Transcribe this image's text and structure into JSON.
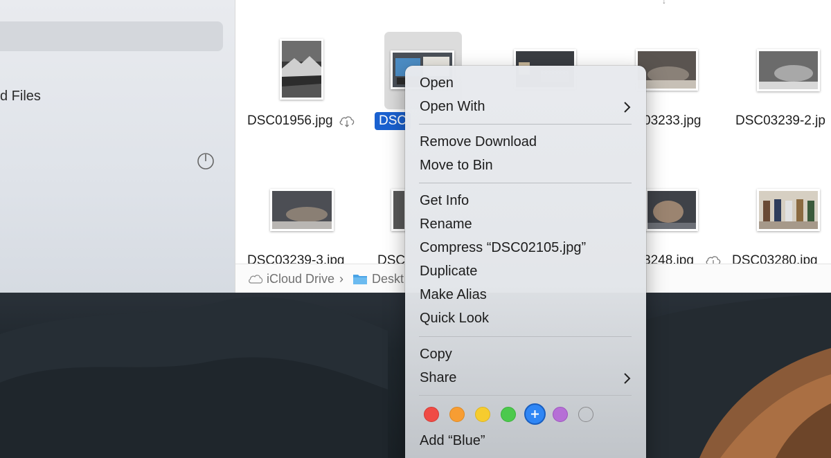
{
  "sidebar": {
    "item_label": "d Files",
    "storage_icon": "storage-progress-icon"
  },
  "files": [
    {
      "name": "DSC01956.jpg",
      "cloud": true
    },
    {
      "name": "DSC",
      "selected": true
    },
    {
      "name": "03233.jpg"
    },
    {
      "name": "DSC03239-2.jp"
    },
    {
      "name": "DSC03239-3.jpg"
    },
    {
      "name": "DSC"
    },
    {
      "name": "3248.jpg",
      "cloud": true
    },
    {
      "name": "DSC03280.jpg",
      "cloud": true
    }
  ],
  "pathbar": {
    "drive": "iCloud Drive",
    "separator": "›",
    "folder": "Deskt"
  },
  "context_menu": {
    "items": [
      {
        "label": "Open"
      },
      {
        "label": "Open With",
        "submenu": true
      },
      {
        "label": "Remove Download"
      },
      {
        "label": "Move to Bin"
      },
      {
        "label": "Get Info"
      },
      {
        "label": "Rename"
      },
      {
        "label": "Compress “DSC02105.jpg”"
      },
      {
        "label": "Duplicate"
      },
      {
        "label": "Make Alias"
      },
      {
        "label": "Quick Look"
      },
      {
        "label": "Copy"
      },
      {
        "label": "Share",
        "submenu": true
      }
    ],
    "tags": [
      {
        "name": "red",
        "color": "#f04b45"
      },
      {
        "name": "orange",
        "color": "#f79d33"
      },
      {
        "name": "yellow",
        "color": "#f6cc2e"
      },
      {
        "name": "green",
        "color": "#4cc94d"
      },
      {
        "name": "blue",
        "color": "#2f86f5",
        "hovered": true
      },
      {
        "name": "purple",
        "color": "#b66fd6"
      },
      {
        "name": "gray",
        "color": "#a5a5a8"
      }
    ],
    "add_tag_label": "Add “Blue”"
  }
}
